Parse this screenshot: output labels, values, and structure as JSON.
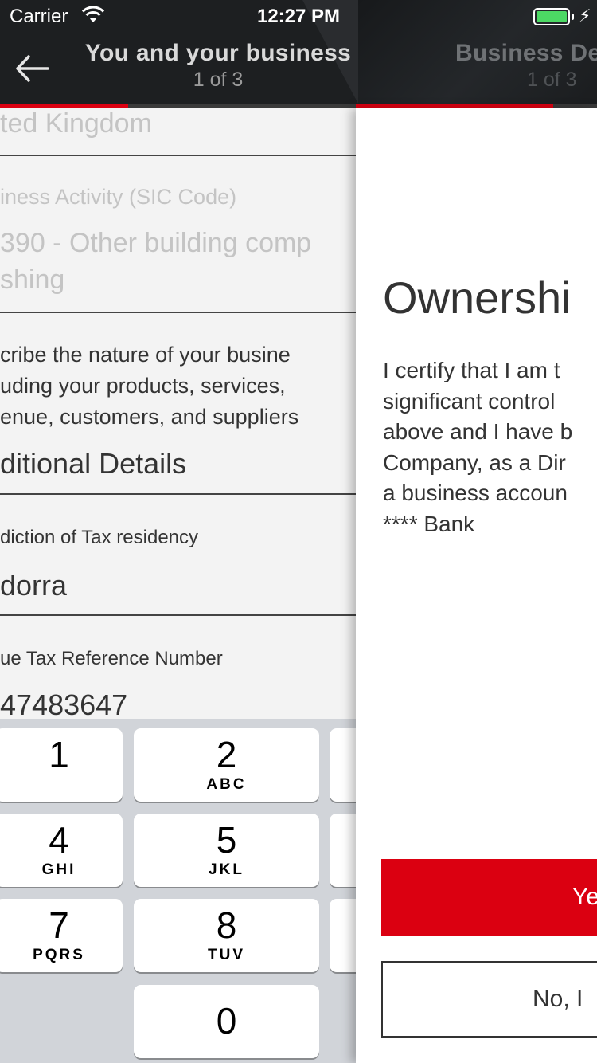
{
  "status_bar": {
    "carrier": "Carrier",
    "time": "12:27 PM",
    "battery_color": "#4cd964"
  },
  "nav": {
    "back_icon": "arrow-left-icon",
    "primary_title": "You and your business",
    "primary_step": "1 of 3",
    "secondary_title": "Business De",
    "secondary_step": "1 of 3"
  },
  "progress": {
    "left_fraction": 0.36,
    "right_fraction": 0.82,
    "accent_color": "#db0011"
  },
  "form": {
    "country_value": "ted Kingdom",
    "business_activity_label": "iness Activity (SIC Code)",
    "business_activity_value_line1": "390 - Other building comp",
    "business_activity_value_line2": "shing",
    "nature_line1": "cribe the nature of your busine",
    "nature_line2": "uding your products, services,",
    "nature_line3": "enue, customers, and suppliers",
    "additional_details_heading": "ditional Details",
    "tax_residency_label": "diction of Tax residency",
    "tax_residency_value": "dorra",
    "tax_ref_label": "ue Tax Reference Number",
    "tax_ref_value": "47483647"
  },
  "keypad": {
    "keys": [
      {
        "digit": "1",
        "letters": ""
      },
      {
        "digit": "2",
        "letters": "ABC"
      },
      {
        "digit": "4",
        "letters": "GHI"
      },
      {
        "digit": "5",
        "letters": "JKL"
      },
      {
        "digit": "7",
        "letters": "PQRS"
      },
      {
        "digit": "8",
        "letters": "TUV"
      },
      {
        "digit": "0",
        "letters": ""
      }
    ]
  },
  "sheet": {
    "title": "Ownershi",
    "body_lines": [
      "I certify that I am t",
      "significant control",
      "above and I have b",
      "Company, as a Dir",
      "a business accoun",
      "**** Bank"
    ],
    "yes_label": "Ye",
    "no_label": "No, I"
  }
}
